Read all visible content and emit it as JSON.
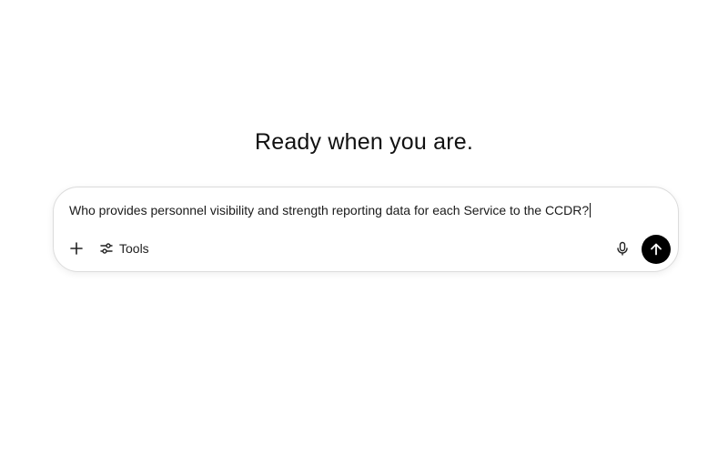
{
  "headline": "Ready when you are.",
  "composer": {
    "input_value": "Who provides personnel visibility and strength reporting data for each Service to the CCDR?",
    "tools_label": "Tools"
  },
  "icons": {
    "add": "plus-icon",
    "tools": "sliders-icon",
    "mic": "microphone-icon",
    "send": "arrow-up-icon"
  },
  "colors": {
    "send_button": "#000000",
    "text": "#0d0d0d"
  }
}
